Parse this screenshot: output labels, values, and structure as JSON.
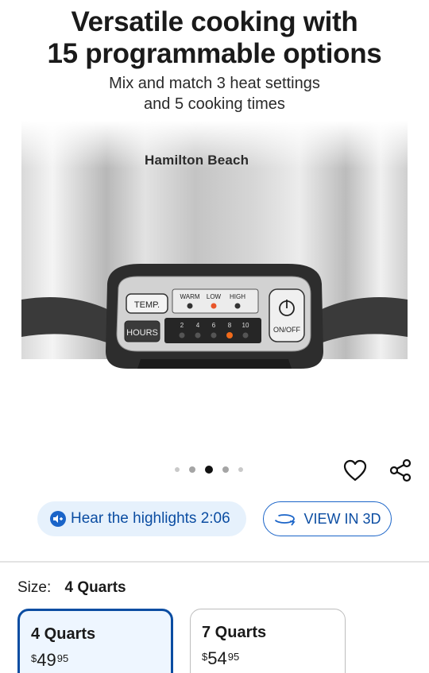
{
  "hero": {
    "title_line1": "Versatile cooking with",
    "title_line2": "15 programmable options",
    "subtitle_line1": "Mix and match 3 heat settings",
    "subtitle_line2": "and 5 cooking times"
  },
  "product": {
    "brand": "Hamilton Beach",
    "panel": {
      "temp_label": "TEMP.",
      "hours_label": "HOURS",
      "heat_settings": [
        "WARM",
        "LOW",
        "HIGH"
      ],
      "active_heat": "LOW",
      "times": [
        "2",
        "4",
        "6",
        "8",
        "10"
      ],
      "active_time": "8",
      "power_label": "ON/OFF"
    }
  },
  "carousel": {
    "dot_count": 5,
    "active_index": 2
  },
  "actions": {
    "favorite_icon": "heart-icon",
    "share_icon": "share-icon"
  },
  "audio": {
    "label": "Hear the highlights 2:06"
  },
  "view3d": {
    "label": "VIEW IN 3D"
  },
  "size": {
    "label": "Size:",
    "selected": "4 Quarts",
    "options": [
      {
        "name": "4 Quarts",
        "currency": "$",
        "dollars": "49",
        "cents": "95",
        "selected": true
      },
      {
        "name": "7 Quarts",
        "currency": "$",
        "dollars": "54",
        "cents": "95",
        "selected": false
      }
    ]
  },
  "colors": {
    "accent": "#0b4da2",
    "audio_bg": "#e6f1fc",
    "selected_bg": "#eef6ff"
  }
}
